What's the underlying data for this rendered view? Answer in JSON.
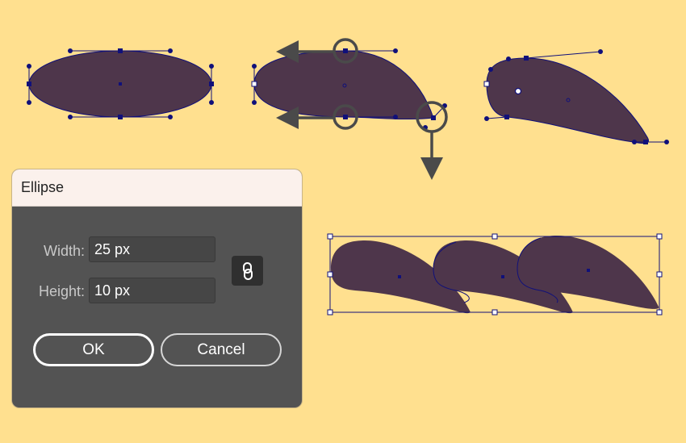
{
  "colors": {
    "background": "#ffe08f",
    "shape_fill": "#4e364b",
    "anchor_points": "#10107a",
    "callout_arrows": "#4a4a4a",
    "dialog_body": "#535353",
    "dialog_titlebar": "#fbf1ec"
  },
  "steps": [
    {
      "description_icon": "ellipse-with-anchors"
    },
    {
      "description_icon": "ellipse-handles-dragged"
    },
    {
      "description_icon": "leaf-shape-result"
    },
    {
      "description_icon": "three-leaves-grouped"
    }
  ],
  "dialog": {
    "title": "Ellipse",
    "width_label": "Width:",
    "width_value": "25 px",
    "height_label": "Height:",
    "height_value": "10 px",
    "link_icon": "chain-link-icon",
    "ok_label": "OK",
    "cancel_label": "Cancel"
  }
}
